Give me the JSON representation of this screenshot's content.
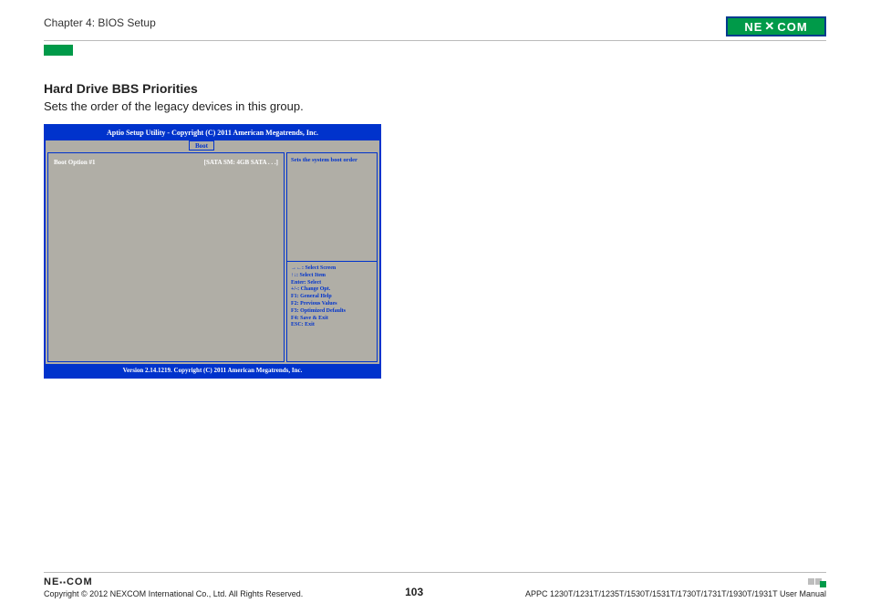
{
  "header": {
    "chapter": "Chapter 4: BIOS Setup",
    "logo_text": "NE COM"
  },
  "section": {
    "title": "Hard Drive BBS Priorities",
    "desc": "Sets the order of the legacy devices in this group."
  },
  "bios": {
    "header": "Aptio Setup Utility - Copyright (C) 2011 American Megatrends, Inc.",
    "tab": "Boot",
    "left": {
      "label": "Boot Option #1",
      "value": "[SATA SM: 4GB SATA . . .]"
    },
    "right_top": "Sets the system boot order",
    "help": {
      "l1": "→←: Select Screen",
      "l2": "↑↓: Select Item",
      "l3": "Enter: Select",
      "l4": "+/-: Change Opt.",
      "l5": "F1: General Help",
      "l6": "F2: Previous Values",
      "l7": "F3: Optimized Defaults",
      "l8": "F4: Save & Exit",
      "l9": "ESC: Exit"
    },
    "footer": "Version 2.14.1219. Copyright (C) 2011 American Megatrends, Inc."
  },
  "footer": {
    "logo": "NE  COM",
    "copyright": "Copyright © 2012 NEXCOM International Co., Ltd. All Rights Reserved.",
    "page": "103",
    "manual": "APPC 1230T/1231T/1235T/1530T/1531T/1730T/1731T/1930T/1931T User Manual"
  }
}
